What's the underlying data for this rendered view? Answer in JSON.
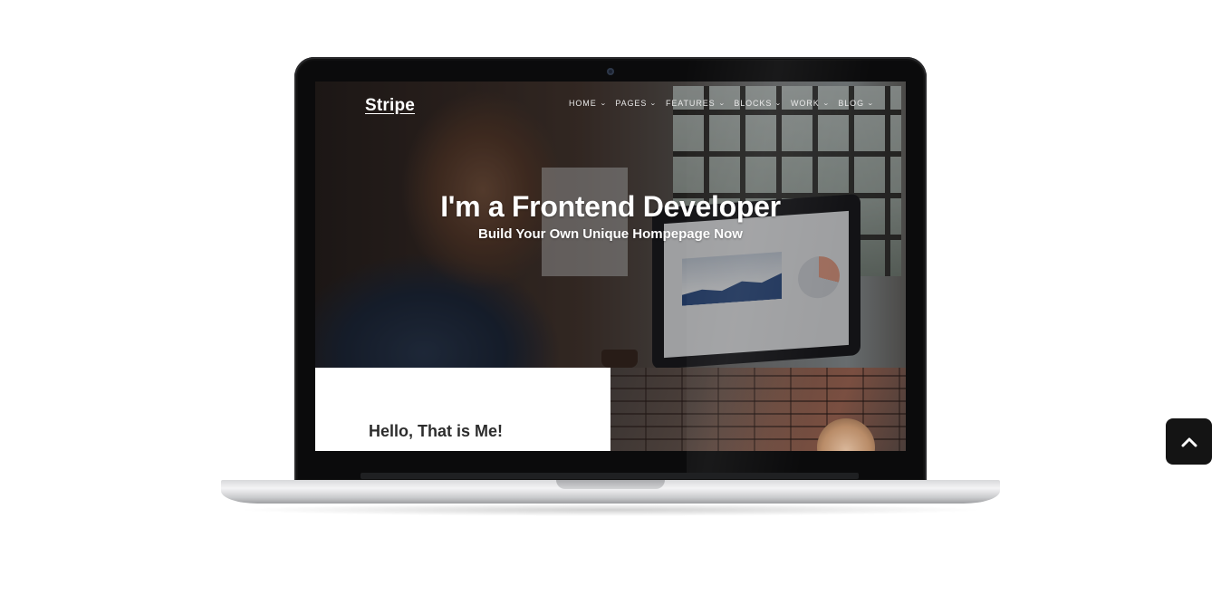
{
  "site": {
    "logo": "Stripe",
    "nav": [
      {
        "label": "HOME"
      },
      {
        "label": "PAGES"
      },
      {
        "label": "FEATURES"
      },
      {
        "label": "BLOCKS"
      },
      {
        "label": "WORK"
      },
      {
        "label": "BLOG"
      }
    ],
    "hero": {
      "title": "I'm a Frontend Developer",
      "subtitle": "Build Your Own Unique Hompepage Now"
    },
    "about": {
      "title": "Hello, That is Me!"
    }
  },
  "icons": {
    "nav_chevron": "chevron-down-icon",
    "back_to_top": "chevron-up-icon"
  },
  "colors": {
    "page_background": "#ffffff",
    "laptop_bezel": "#0b0b0c",
    "back_to_top_bg": "#141414",
    "hero_text": "#ffffff"
  }
}
